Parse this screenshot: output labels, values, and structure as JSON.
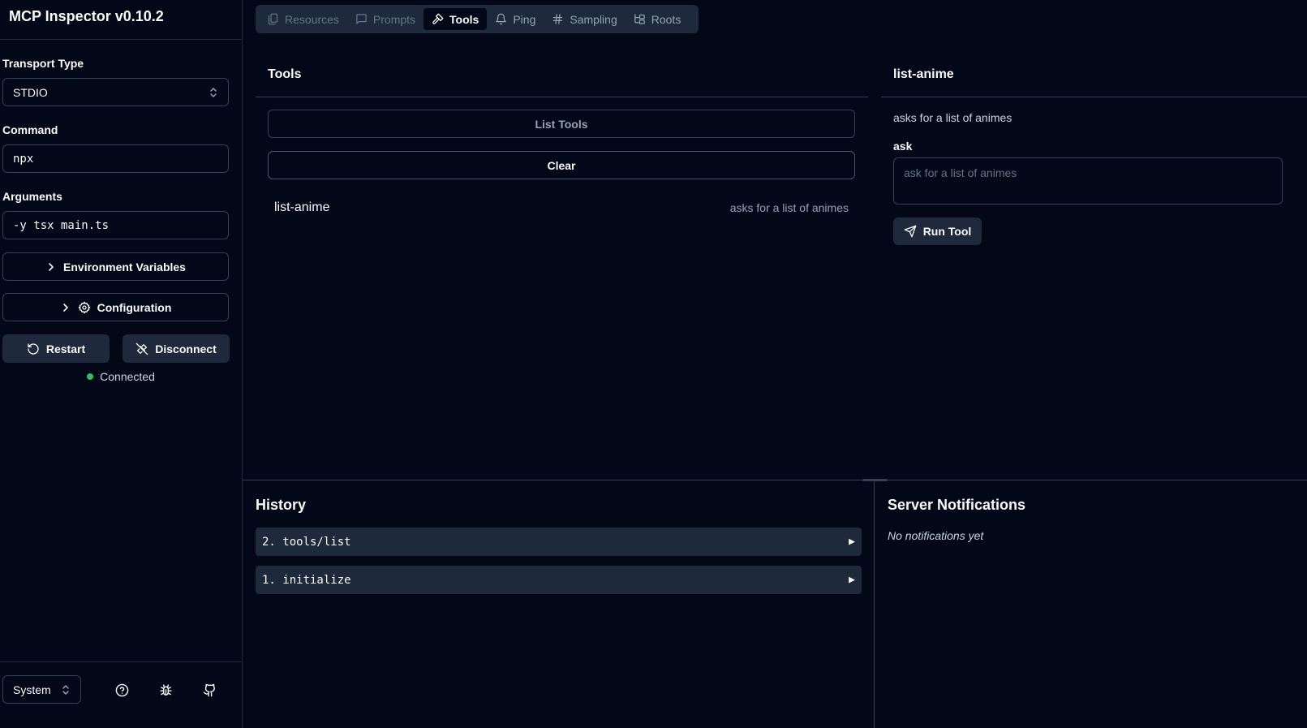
{
  "app": {
    "title": "MCP Inspector v0.10.2"
  },
  "sidebar": {
    "transport_label": "Transport Type",
    "transport_value": "STDIO",
    "command_label": "Command",
    "command_value": "npx",
    "arguments_label": "Arguments",
    "arguments_value": "-y tsx main.ts",
    "env_button": "Environment Variables",
    "config_button": "Configuration",
    "restart_button": "Restart",
    "disconnect_button": "Disconnect",
    "status": "Connected",
    "theme_value": "System"
  },
  "tabs": [
    {
      "label": "Resources",
      "icon": "files-icon",
      "state": "disabled"
    },
    {
      "label": "Prompts",
      "icon": "message-icon",
      "state": "disabled"
    },
    {
      "label": "Tools",
      "icon": "hammer-icon",
      "state": "active"
    },
    {
      "label": "Ping",
      "icon": "bell-icon",
      "state": "normal"
    },
    {
      "label": "Sampling",
      "icon": "hash-icon",
      "state": "normal"
    },
    {
      "label": "Roots",
      "icon": "folder-tree-icon",
      "state": "normal"
    }
  ],
  "tools_panel": {
    "title": "Tools",
    "list_button": "List Tools",
    "clear_button": "Clear",
    "items": [
      {
        "name": "list-anime",
        "description": "asks for a list of animes"
      }
    ]
  },
  "tool_detail": {
    "title": "list-anime",
    "description": "asks for a list of animes",
    "param_label": "ask",
    "param_placeholder": "ask for a list of animes",
    "run_button": "Run Tool"
  },
  "history": {
    "title": "History",
    "items": [
      {
        "label": "2. tools/list"
      },
      {
        "label": "1. initialize"
      }
    ]
  },
  "notifications": {
    "title": "Server Notifications",
    "empty": "No notifications yet"
  },
  "colors": {
    "background": "#020817",
    "surface": "#1e293b",
    "border": "#334155",
    "status_ok": "#22c55e"
  }
}
